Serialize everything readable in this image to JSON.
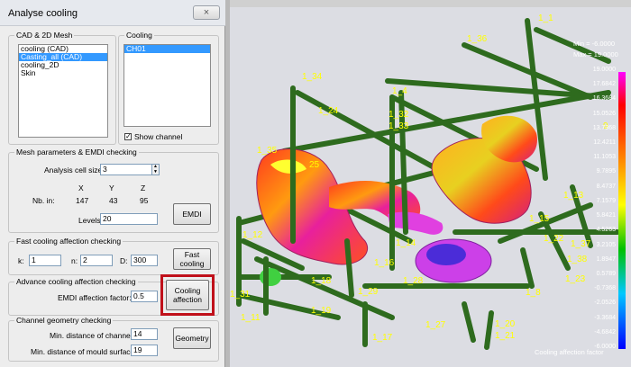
{
  "window": {
    "title": "Analyse cooling",
    "close_glyph": "×"
  },
  "cad_mesh": {
    "label": "CAD & 2D Mesh",
    "items": [
      "cooling (CAD)",
      "Casting_all (CAD)",
      "cooling_2D",
      "Skin"
    ],
    "selected_index": 1
  },
  "cooling": {
    "label": "Cooling",
    "items": [
      "CH01"
    ],
    "selected_index": 0,
    "show_channel_label": "Show channel",
    "show_channel_checked": true
  },
  "mesh": {
    "label": "Mesh parameters & EMDI checking",
    "cell_size_label": "Analysis cell size:",
    "cell_size_value": "3",
    "x_header": "X",
    "y_header": "Y",
    "z_header": "Z",
    "nb_label": "Nb. in:",
    "nb_x": "147",
    "nb_y": "43",
    "nb_z": "95",
    "levels_label": "Levels:",
    "levels_value": "20",
    "emdi_button": "EMDI"
  },
  "fast": {
    "label": "Fast cooling affection checking",
    "k_label": "k:",
    "k_value": "1",
    "n_label": "n:",
    "n_value": "2",
    "d_label": "D:",
    "d_value": "300",
    "button_line1": "Fast",
    "button_line2": "cooling"
  },
  "advance": {
    "label": "Advance cooling affection checking",
    "factor_label": "EMDI affection factor:",
    "factor_value": "0.5",
    "button_line1": "Cooling",
    "button_line2": "affection"
  },
  "geometry": {
    "label": "Channel geometry checking",
    "min_channel_label": "Min. distance of channel:",
    "min_channel_value": "14",
    "min_mould_label": "Min. distance of mould surface:",
    "min_mould_value": "19",
    "button": "Geometry"
  },
  "viewport": {
    "min_text": "Min = -6.0000",
    "max_text": "Max = 19.0000",
    "scale_values": [
      "19.0000",
      "17.6842",
      "16.3684",
      "15.0526",
      "13.7368",
      "12.4211",
      "11.1053",
      "9.7895",
      "8.4737",
      "7.1579",
      "5.8421",
      "4.5263",
      "3.2105",
      "1.8947",
      "0.5789",
      "-0.7368",
      "-2.0526",
      "-3.3684",
      "-4.6842",
      "-6.0000"
    ],
    "footer": "Cooling affection factor",
    "channel_labels": [
      "1_1",
      "1_36",
      "1_34",
      "1_4",
      "1_24",
      "1_32",
      "1_33",
      "1_35",
      "25",
      "1_12",
      "1_14",
      "1_16",
      "1_18",
      "1_28",
      "1_29",
      "1_19",
      "1_11",
      "1_31",
      "1_17",
      "1_27",
      "1_8",
      "1_20",
      "1_21",
      "1_13",
      "1_22",
      "1_15",
      "1_37",
      "1_38",
      "1_23",
      "9"
    ],
    "colors": {
      "channel": "#2e6b1e",
      "label": "#ffff00",
      "background": "#dcdde3",
      "highlight": "#c0101a"
    }
  }
}
